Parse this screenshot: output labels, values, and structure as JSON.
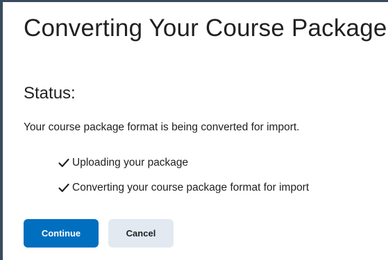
{
  "header": {
    "title": "Converting Your Course Package"
  },
  "status": {
    "heading": "Status:",
    "message": "Your course package format is being converted for import."
  },
  "steps": [
    {
      "label": "Uploading your package",
      "icon": "check-icon",
      "complete": true
    },
    {
      "label": "Converting your course package format for import",
      "icon": "check-icon",
      "complete": true
    }
  ],
  "actions": {
    "continue_label": "Continue",
    "cancel_label": "Cancel"
  },
  "colors": {
    "primary": "#006fbf",
    "secondary": "#e3e9f1",
    "text": "#202122",
    "frame": "#3b4a5e"
  }
}
